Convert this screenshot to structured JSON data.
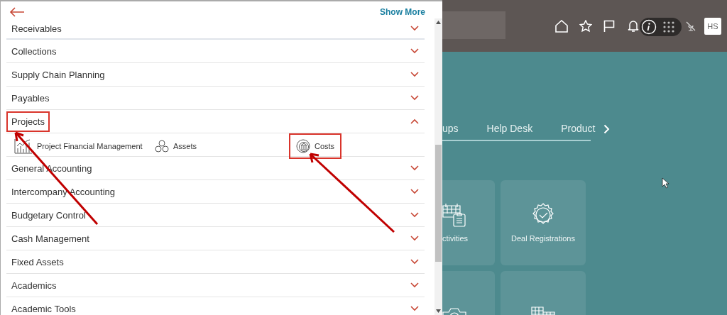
{
  "panel": {
    "show_more": "Show More",
    "sections": [
      {
        "label": "Receivables",
        "expanded": false,
        "highlighted": false
      },
      {
        "label": "Collections",
        "expanded": false,
        "highlighted": false
      },
      {
        "label": "Supply Chain Planning",
        "expanded": false,
        "highlighted": false
      },
      {
        "label": "Payables",
        "expanded": false,
        "highlighted": false
      },
      {
        "label": "Projects",
        "expanded": true,
        "highlighted": true,
        "children": [
          {
            "label": "Project Financial Management",
            "kind": "chart",
            "highlighted": false
          },
          {
            "label": "Assets",
            "kind": "circles",
            "highlighted": false
          },
          {
            "label": "Costs",
            "kind": "bank",
            "highlighted": true
          }
        ]
      },
      {
        "label": "General Accounting",
        "expanded": false,
        "highlighted": false
      },
      {
        "label": "Intercompany Accounting",
        "expanded": false,
        "highlighted": false
      },
      {
        "label": "Budgetary Control",
        "expanded": false,
        "highlighted": false
      },
      {
        "label": "Cash Management",
        "expanded": false,
        "highlighted": false
      },
      {
        "label": "Fixed Assets",
        "expanded": false,
        "highlighted": false
      },
      {
        "label": "Academics",
        "expanded": false,
        "highlighted": false
      },
      {
        "label": "Academic Tools",
        "expanded": false,
        "highlighted": false
      }
    ]
  },
  "header": {
    "avatar": "HS"
  },
  "tabs": [
    {
      "label": "ups"
    },
    {
      "label": "Help Desk"
    },
    {
      "label": "Product"
    }
  ],
  "tiles": [
    {
      "label": "ctivities",
      "kind": "calendar"
    },
    {
      "label": "Deal Registrations",
      "kind": "seal"
    },
    {
      "kind": "camera"
    },
    {
      "kind": "building"
    }
  ]
}
